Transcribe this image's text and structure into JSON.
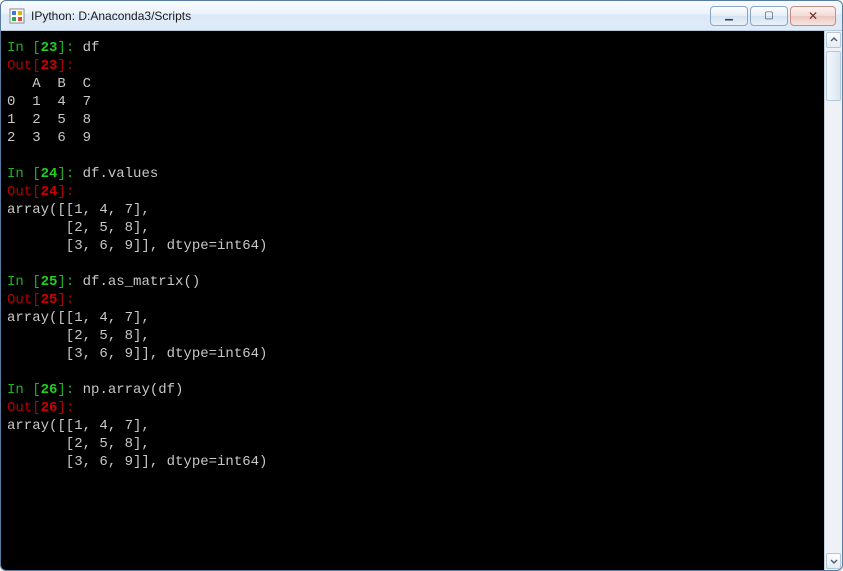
{
  "window": {
    "title": "IPython: D:Anaconda3/Scripts"
  },
  "cells": [
    {
      "in_num": "23",
      "out_num": "23",
      "input": "df",
      "output": "   A  B  C\n0  1  4  7\n1  2  5  8\n2  3  6  9"
    },
    {
      "in_num": "24",
      "out_num": "24",
      "input": "df.values",
      "output": "array([[1, 4, 7],\n       [2, 5, 8],\n       [3, 6, 9]], dtype=int64)"
    },
    {
      "in_num": "25",
      "out_num": "25",
      "input": "df.as_matrix()",
      "output": "array([[1, 4, 7],\n       [2, 5, 8],\n       [3, 6, 9]], dtype=int64)"
    },
    {
      "in_num": "26",
      "out_num": "26",
      "input": "np.array(df)",
      "output": "array([[1, 4, 7],\n       [2, 5, 8],\n       [3, 6, 9]], dtype=int64)"
    }
  ]
}
